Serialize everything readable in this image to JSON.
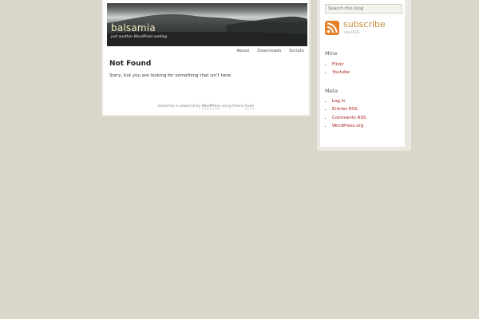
{
  "blog": {
    "title": "balsamia",
    "description": "just another WordPress weblog"
  },
  "nav": {
    "items": [
      "About",
      "Downloads",
      "Scripts"
    ]
  },
  "content": {
    "title": "Not Found",
    "message": "Sorry, but you are looking for something that isn't here."
  },
  "footer": {
    "prefix": "balsamia is powered by",
    "wordpress_link": "WordPress",
    "middle": "using theme",
    "theme_link": "Exile"
  },
  "sidebar": {
    "search_placeholder": "Search this blog",
    "subscribe": {
      "label": "subscribe",
      "sub": "via RSS",
      "icon": "rss-icon"
    },
    "mine": {
      "title": "Mine",
      "links": [
        "Flickr",
        "Youtube"
      ]
    },
    "meta": {
      "title": "Meta",
      "links": [
        "Log in",
        "Entries RSS",
        "Comments RSS",
        "WordPress.org"
      ]
    }
  },
  "colors": {
    "background": "#d9d6ca",
    "link": "#a8201a",
    "subscribe": "#c88a3f",
    "rss": "#e57f28",
    "title": "#f4ecc0"
  }
}
